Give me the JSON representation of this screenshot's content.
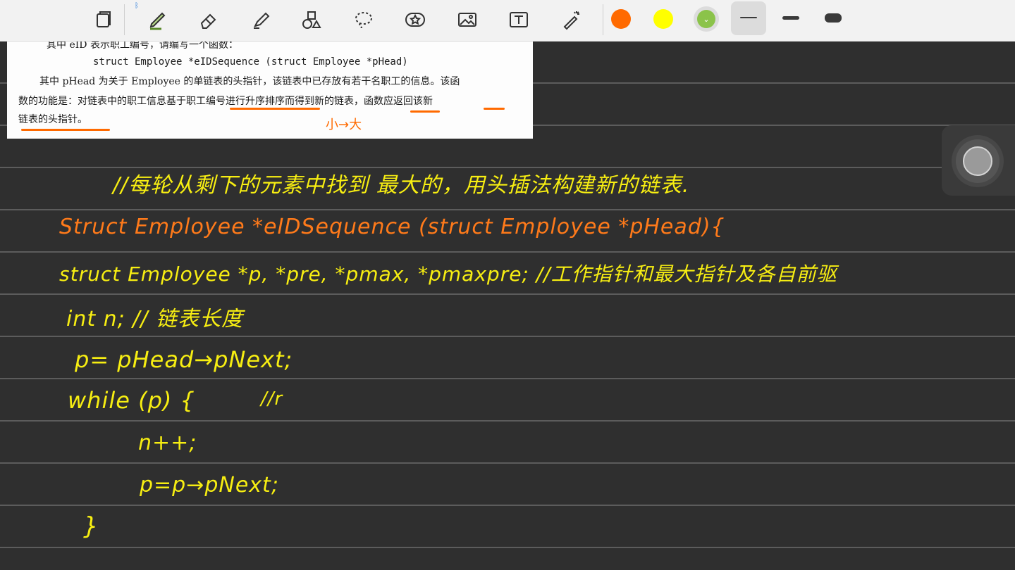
{
  "toolbar": {
    "tools": [
      {
        "name": "page-view-icon"
      },
      {
        "name": "pen-icon"
      },
      {
        "name": "eraser-icon"
      },
      {
        "name": "highlighter-icon"
      },
      {
        "name": "shapes-icon"
      },
      {
        "name": "lasso-icon"
      },
      {
        "name": "sticker-icon"
      },
      {
        "name": "image-icon"
      },
      {
        "name": "text-box-icon"
      },
      {
        "name": "laser-pointer-icon"
      }
    ],
    "bluetooth_glyph": "ᛒ",
    "colors": {
      "orange": "#ff6a00",
      "yellow": "#ffff00",
      "green_selected": "#8bc34a"
    },
    "thickness_selected": "medium"
  },
  "document": {
    "line1": "其中 eID 表示职工编号，请编写一个函数：",
    "line2": "struct Employee *eIDSequence (struct Employee  *pHead)",
    "line3": "其中 pHead 为关于 Employee 的单链表的头指针，该链表中已存放有若干名职工的信息。该函",
    "line4": "数的功能是：对链表中的职工信息基于职工编号进行升序排序而得到新的链表，函数应返回该新",
    "line5": "链表的头指针。",
    "annotation": "小→大"
  },
  "notes": {
    "comment": "//每轮从剩下的元素中找到 最大的，用头插法构建新的链表.",
    "signature": "Struct  Employee   *eIDSequence (struct  Employee  *pHead){",
    "decl": "struct Employee *p, *pre, *pmax, *pmaxpre; //工作指针和最大指针及各自前驱",
    "int_line": "int n; //  链表长度",
    "p_assign": "p= pHead→pNext;",
    "while_line": "while (p) {",
    "while_comment": "//r",
    "n_inc": "n++;",
    "p_next": "p=p→pNext;",
    "close_brace": "}"
  }
}
